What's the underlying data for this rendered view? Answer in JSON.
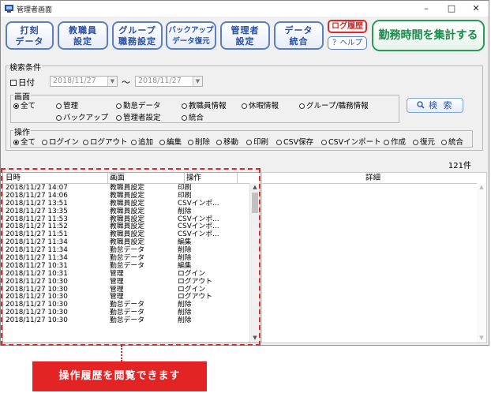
{
  "window": {
    "title": "管理者画面",
    "minimize": "–",
    "maximize": "□",
    "close": "✕"
  },
  "toolbar": {
    "buttons": [
      {
        "line1": "打刻",
        "line2": "データ"
      },
      {
        "line1": "教職員",
        "line2": "設定"
      },
      {
        "line1": "グループ",
        "line2": "職務設定"
      },
      {
        "line1": "バックアップ",
        "line2": "データ復元"
      },
      {
        "line1": "管理者",
        "line2": "設定"
      },
      {
        "line1": "データ",
        "line2": "統合"
      }
    ],
    "log_history": "ログ履歴",
    "help": "？ヘルプ",
    "aggregate": "勤務時間を集計する"
  },
  "search": {
    "label": "検索条件",
    "date_checkbox": "日付",
    "date_from": "2018/11/27",
    "date_to": "2018/11/27",
    "tilde": "～",
    "dropdown_arrow": "▼",
    "screen_label": "画面",
    "screens": [
      "全て",
      "管理",
      "勤怠データ",
      "教職員情報",
      "休暇情報",
      "グループ/職務情報",
      "バックアップ",
      "管理者設定",
      "統合"
    ],
    "ops_label": "操作",
    "operations": [
      "全て",
      "ログイン",
      "ログアウト",
      "追加",
      "編集",
      "削除",
      "移動",
      "印刷",
      "CSV保存",
      "CSVインポート",
      "作成",
      "復元",
      "統合"
    ],
    "search_button": "検 索",
    "search_icon": "magnifier-icon"
  },
  "result_count": "121件",
  "table": {
    "headers": {
      "datetime": "日時",
      "screen": "画面",
      "operation": "操作",
      "detail": "詳細"
    },
    "rows": [
      {
        "datetime": "2018/11/27 14:07",
        "screen": "教職員設定",
        "operation": "印刷"
      },
      {
        "datetime": "2018/11/27 14:06",
        "screen": "教職員設定",
        "operation": "印刷"
      },
      {
        "datetime": "2018/11/27 13:51",
        "screen": "教職員設定",
        "operation": "CSVインポ..."
      },
      {
        "datetime": "2018/11/27 13:35",
        "screen": "教職員設定",
        "operation": "削除"
      },
      {
        "datetime": "2018/11/27 11:53",
        "screen": "教職員設定",
        "operation": "CSVインポ..."
      },
      {
        "datetime": "2018/11/27 11:52",
        "screen": "教職員設定",
        "operation": "CSVインポ..."
      },
      {
        "datetime": "2018/11/27 11:51",
        "screen": "教職員設定",
        "operation": "CSVインポ..."
      },
      {
        "datetime": "2018/11/27 11:34",
        "screen": "教職員設定",
        "operation": "編集"
      },
      {
        "datetime": "2018/11/27 11:34",
        "screen": "勤怠データ",
        "operation": "削除"
      },
      {
        "datetime": "2018/11/27 11:34",
        "screen": "勤怠データ",
        "operation": "削除"
      },
      {
        "datetime": "2018/11/27 10:31",
        "screen": "勤怠データ",
        "operation": "編集"
      },
      {
        "datetime": "2018/11/27 10:31",
        "screen": "管理",
        "operation": "ログイン"
      },
      {
        "datetime": "2018/11/27 10:30",
        "screen": "管理",
        "operation": "ログアウト"
      },
      {
        "datetime": "2018/11/27 10:30",
        "screen": "管理",
        "operation": "ログイン"
      },
      {
        "datetime": "2018/11/27 10:30",
        "screen": "管理",
        "operation": "ログアウト"
      },
      {
        "datetime": "2018/11/27 10:30",
        "screen": "勤怠データ",
        "operation": "削除"
      },
      {
        "datetime": "2018/11/27 10:30",
        "screen": "勤怠データ",
        "operation": "削除"
      },
      {
        "datetime": "2018/11/27 10:30",
        "screen": "勤怠データ",
        "operation": "削除"
      }
    ]
  },
  "callout": "操作履歴を閲覧できます",
  "colors": {
    "accent_blue": "#2a4fa0",
    "accent_red": "#d62a2a",
    "accent_green": "#1c8a4c"
  }
}
